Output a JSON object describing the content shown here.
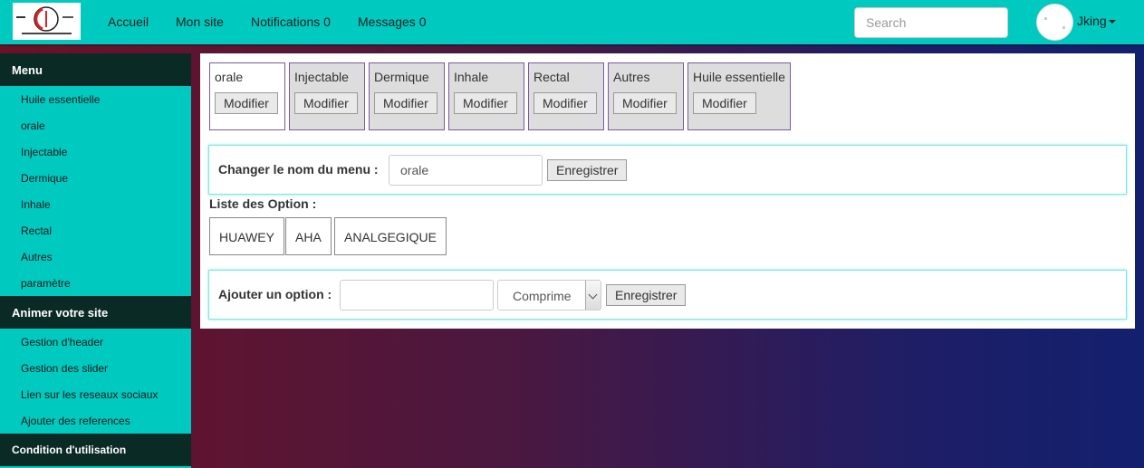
{
  "navbar": {
    "links": [
      "Accueil",
      "Mon site",
      "Notifications 0",
      "Messages 0"
    ],
    "search_placeholder": "Search",
    "user": "Jking"
  },
  "sidebar": {
    "sections": [
      {
        "title": "Menu",
        "items": [
          "Huile essentielle",
          "orale",
          "Injectable",
          "Dermique",
          "Inhale",
          "Rectal",
          "Autres",
          "paramètre"
        ]
      },
      {
        "title": "Animer votre site",
        "items": [
          "Gestion d'header",
          "Gestion des slider",
          "Lien sur les reseaux sociaux",
          "Ajouter des references"
        ]
      },
      {
        "title": "Condition d'utilisation",
        "items": []
      }
    ]
  },
  "tabs": [
    {
      "label": "orale",
      "button": "Modifier"
    },
    {
      "label": "Injectable",
      "button": "Modifier"
    },
    {
      "label": "Dermique",
      "button": "Modifier"
    },
    {
      "label": "Inhale",
      "button": "Modifier"
    },
    {
      "label": "Rectal",
      "button": "Modifier"
    },
    {
      "label": "Autres",
      "button": "Modifier"
    },
    {
      "label": "Huile essentielle",
      "button": "Modifier"
    }
  ],
  "rename": {
    "label": "Changer le nom du menu :",
    "value": "orale",
    "button": "Enregistrer"
  },
  "options": {
    "title": "Liste des Option :",
    "items": [
      "HUAWEY",
      "AHA",
      "ANALGEGIQUE"
    ]
  },
  "add_option": {
    "label": "Ajouter un option :",
    "value": "",
    "select_value": "Comprime",
    "button": "Enregistrer"
  }
}
